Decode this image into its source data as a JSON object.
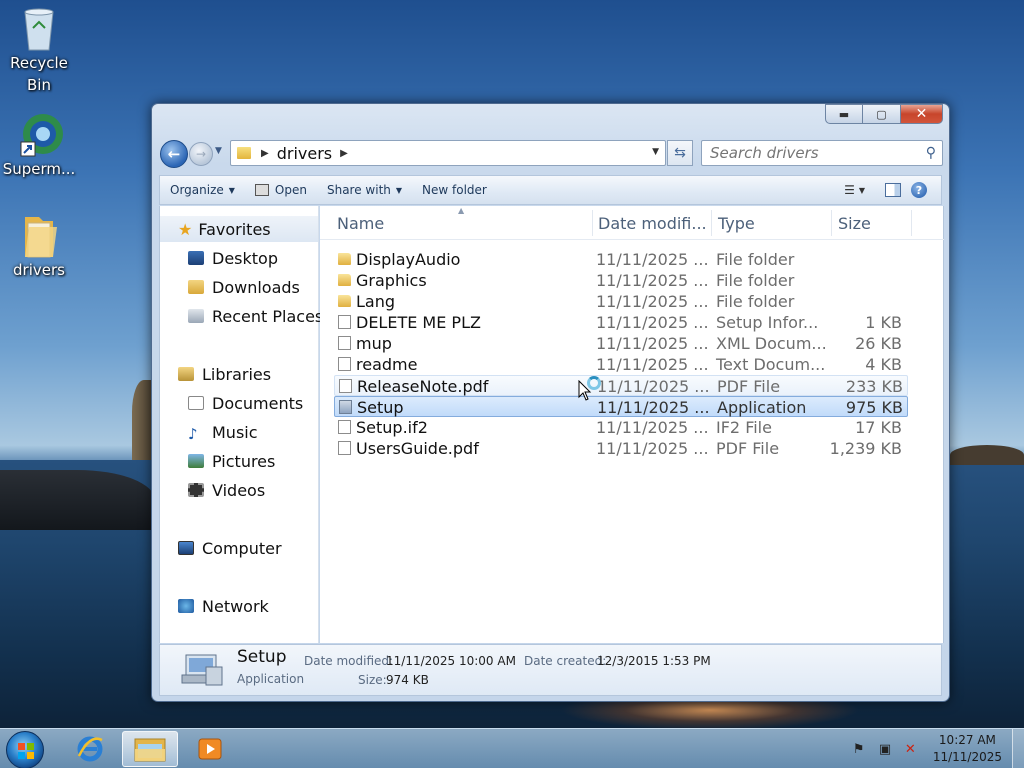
{
  "desktop": {
    "icons": [
      {
        "label": "Recycle\nBin",
        "label_line1": "Recycle",
        "label_line2": "Bin",
        "icon": "recycle-bin-icon"
      },
      {
        "label": "Superm...",
        "icon": "app-shortcut-icon"
      },
      {
        "label": "drivers",
        "icon": "folder-icon"
      }
    ]
  },
  "window": {
    "address": {
      "path": "drivers"
    },
    "search": {
      "placeholder": "Search drivers"
    },
    "toolbar": {
      "organize": "Organize",
      "open": "Open",
      "share_with": "Share with",
      "new_folder": "New folder"
    },
    "nav": {
      "favorites": "Favorites",
      "desktop": "Desktop",
      "downloads": "Downloads",
      "recent_places": "Recent Places",
      "libraries": "Libraries",
      "documents": "Documents",
      "music": "Music",
      "pictures": "Pictures",
      "videos": "Videos",
      "computer": "Computer",
      "network": "Network"
    },
    "columns": {
      "name": "Name",
      "date": "Date modifi...",
      "type": "Type",
      "size": "Size"
    },
    "files": [
      {
        "name": "DisplayAudio",
        "date": "11/11/2025 ...",
        "type": "File folder",
        "size": "",
        "icon": "folder"
      },
      {
        "name": "Graphics",
        "date": "11/11/2025 ...",
        "type": "File folder",
        "size": "",
        "icon": "folder"
      },
      {
        "name": "Lang",
        "date": "11/11/2025 ...",
        "type": "File folder",
        "size": "",
        "icon": "folder"
      },
      {
        "name": "DELETE ME PLZ",
        "date": "11/11/2025 ...",
        "type": "Setup Infor...",
        "size": "1 KB",
        "icon": "doc"
      },
      {
        "name": "mup",
        "date": "11/11/2025 ...",
        "type": "XML Docum...",
        "size": "26 KB",
        "icon": "doc"
      },
      {
        "name": "readme",
        "date": "11/11/2025 ...",
        "type": "Text Docum...",
        "size": "4 KB",
        "icon": "doc"
      },
      {
        "name": "ReleaseNote.pdf",
        "date": "11/11/2025 ...",
        "type": "PDF File",
        "size": "233 KB",
        "icon": "doc"
      },
      {
        "name": "Setup",
        "date": "11/11/2025 ...",
        "type": "Application",
        "size": "975 KB",
        "icon": "app"
      },
      {
        "name": "Setup.if2",
        "date": "11/11/2025 ...",
        "type": "IF2 File",
        "size": "17 KB",
        "icon": "doc"
      },
      {
        "name": "UsersGuide.pdf",
        "date": "11/11/2025 ...",
        "type": "PDF File",
        "size": "1,239 KB",
        "icon": "doc"
      }
    ],
    "details": {
      "name": "Setup",
      "type": "Application",
      "date_modified_label": "Date modified:",
      "date_modified": "11/11/2025 10:00 AM",
      "date_created_label": "Date created:",
      "date_created": "12/3/2015 1:53 PM",
      "size_label": "Size:",
      "size": "974 KB"
    }
  },
  "taskbar": {
    "clock_time": "10:27 AM",
    "clock_date": "11/11/2025"
  },
  "colors": {
    "selection": "#c1dbfa",
    "accent": "#2c66b5"
  }
}
